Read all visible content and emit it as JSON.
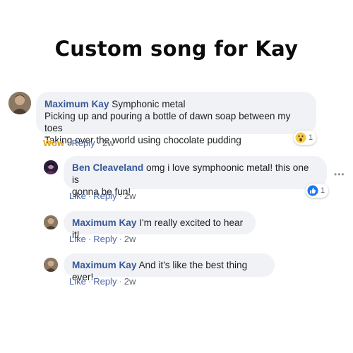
{
  "title": "Custom song for Kay",
  "comments": [
    {
      "author": "Maximum Kay",
      "first_line": "Symphonic metal",
      "lines": [
        "Picking up and pouring a bottle of dawn soap between my toes",
        "Taking over the world using chocolate pudding"
      ],
      "reaction_label": "Wow",
      "reply": "Reply",
      "age": "2w",
      "reaction_icon": "wow-emoji-icon",
      "reaction_count": "1"
    }
  ],
  "replies": [
    {
      "author": "Ben Cleaveland",
      "text_line1": "omg i love symphoonic metal! this one is",
      "text_line2": "gonna be fun!",
      "like": "Like",
      "reply": "Reply",
      "age": "2w",
      "reaction_icon": "like-thumb-icon",
      "reaction_count": "1",
      "more": "•••"
    },
    {
      "author": "Maximum Kay",
      "text": "I'm really excited to hear it!",
      "like": "Like",
      "reply": "Reply",
      "age": "2w"
    },
    {
      "author": "Maximum Kay",
      "text": "And it's like the best thing ever!",
      "like": "Like",
      "reply": "Reply",
      "age": "2w"
    }
  ],
  "colors": {
    "author": "#385898",
    "action": "#4b66a8",
    "bubble": "#f1f2f6",
    "wow": "#e0a11b",
    "like_blue": "#1877f2"
  }
}
